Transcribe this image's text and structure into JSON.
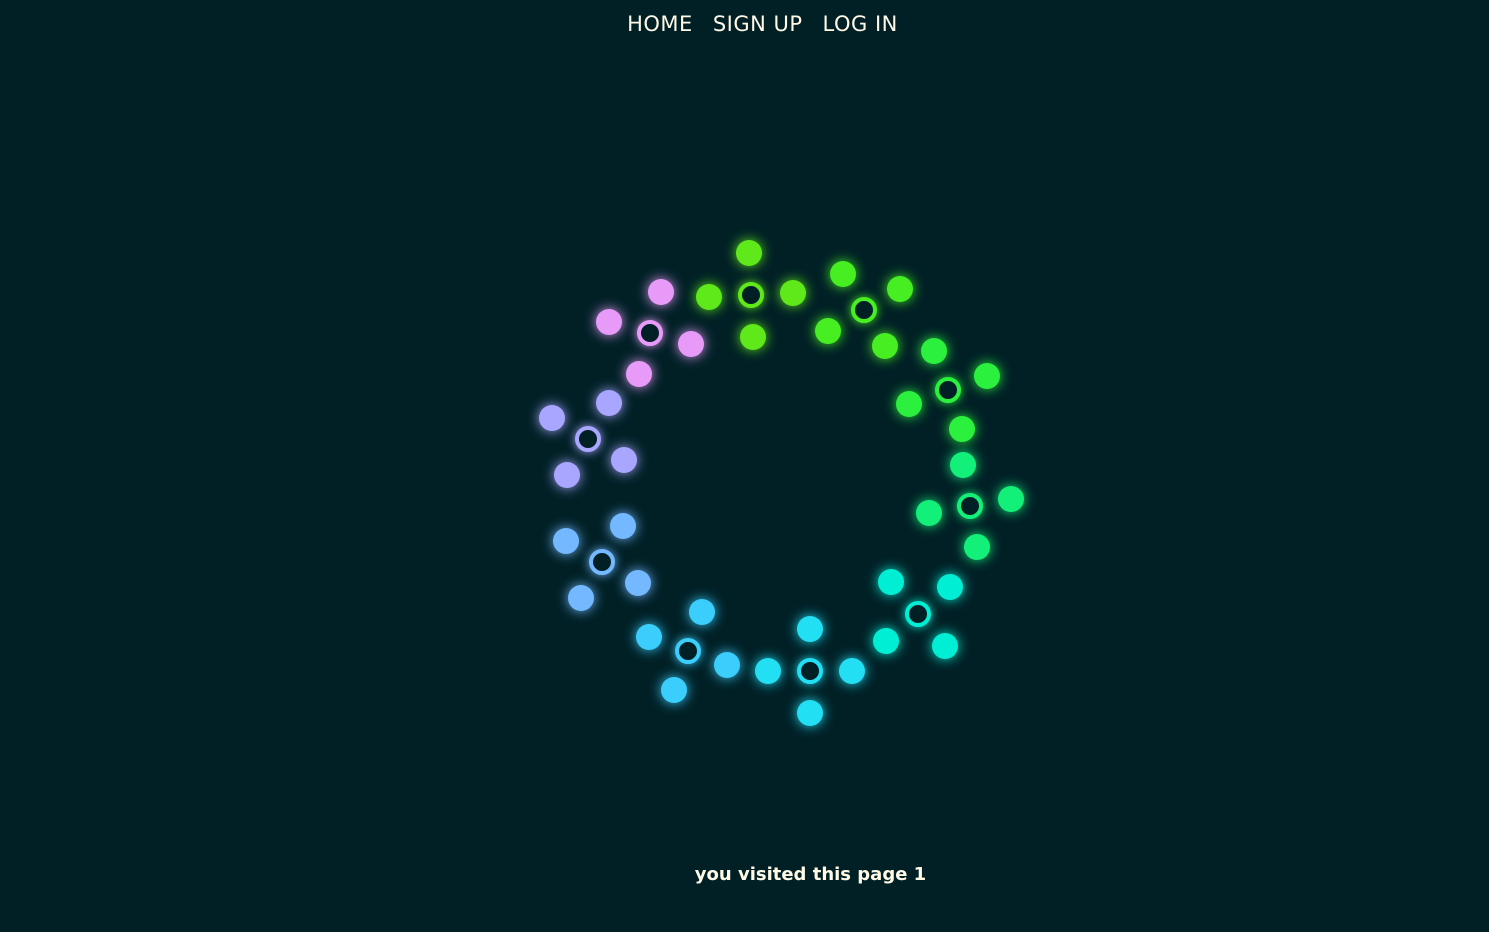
{
  "nav": {
    "home": "HOME",
    "signup": "SIGN UP",
    "login": "LOG IN"
  },
  "loader": {
    "groups": [
      {
        "color": "#5fe81a"
      },
      {
        "color": "#46ee22"
      },
      {
        "color": "#2cf03e"
      },
      {
        "color": "#13f07a"
      },
      {
        "color": "#00eed4"
      },
      {
        "color": "#22dff4"
      },
      {
        "color": "#3bcdfb"
      },
      {
        "color": "#74b8ff"
      },
      {
        "color": "#a9a6ff"
      },
      {
        "color": "#e79af7"
      }
    ]
  },
  "footer": {
    "visits_text": "you visited this page 1"
  }
}
